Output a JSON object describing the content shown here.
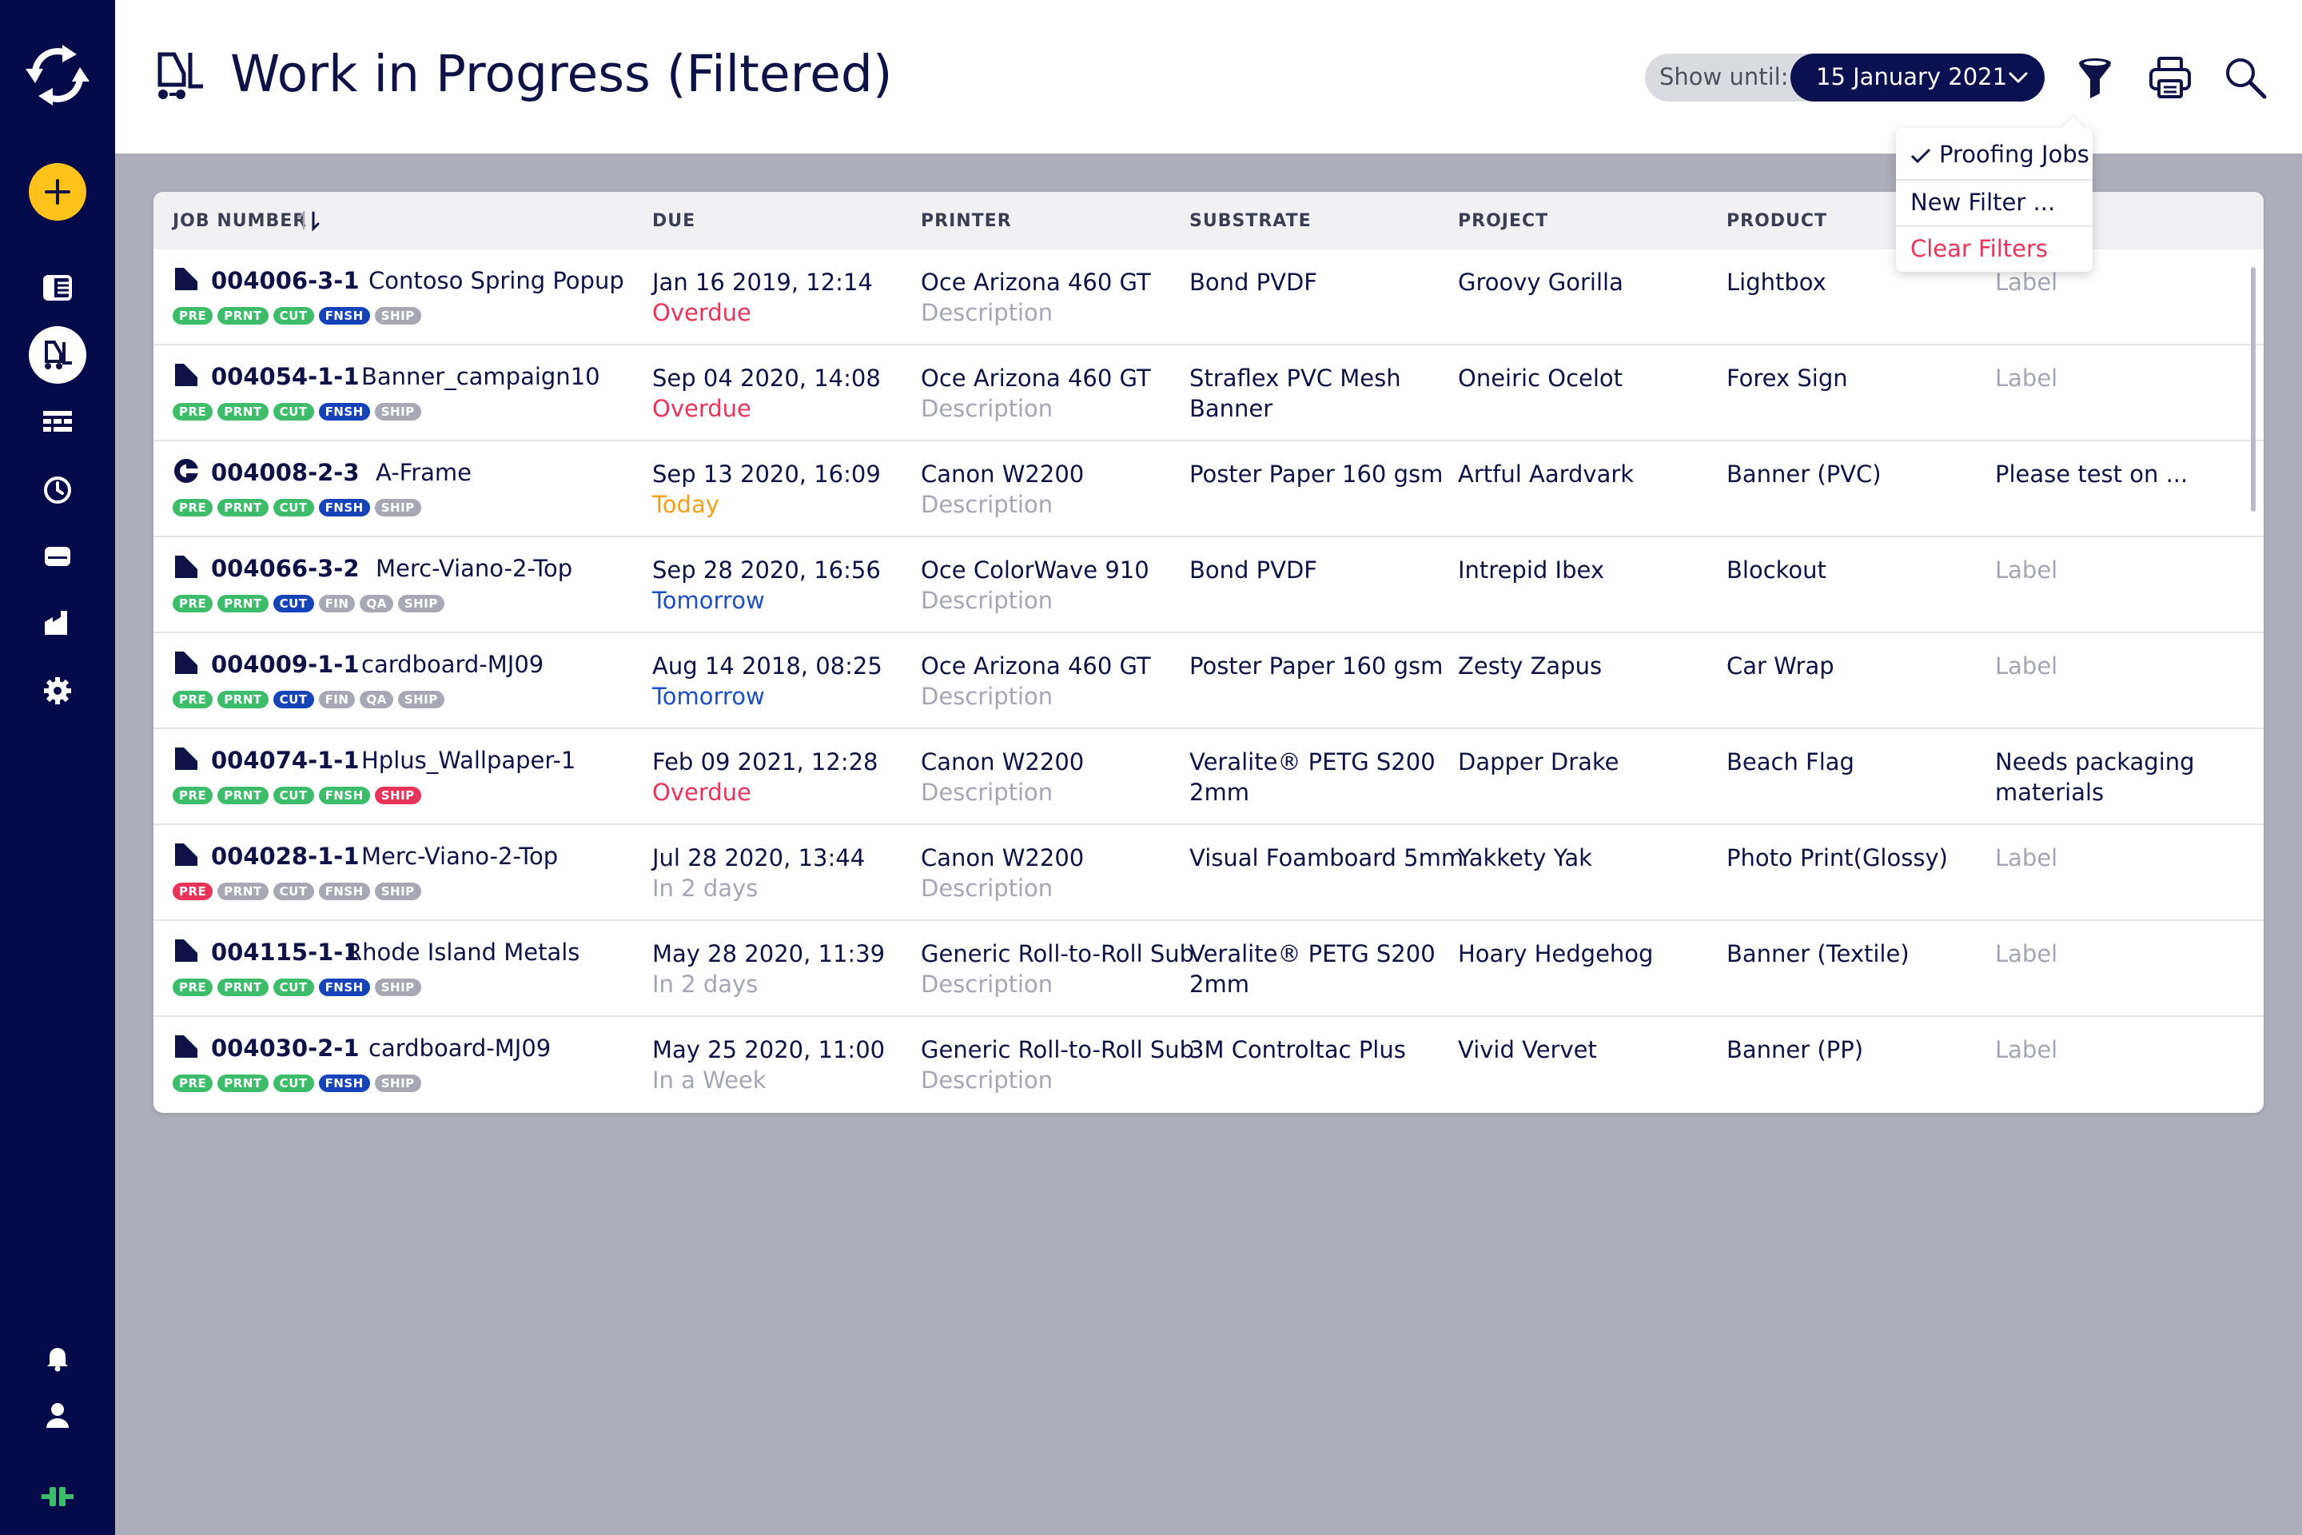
{
  "sidebar": {
    "logo": "refresh-cycle-logo",
    "add_icon": "plus-icon",
    "nav": [
      "list-icon",
      "work-in-progress-icon",
      "board-icon",
      "clock-icon",
      "printer-icon",
      "factory-icon",
      "gear-icon"
    ],
    "bottom": [
      "bell-icon",
      "user-icon",
      "connector-icon"
    ],
    "active_item": "work-in-progress-icon"
  },
  "header": {
    "title": "Work in Progress (Filtered)",
    "title_icon": "forklift-icon",
    "show_until_label": "Show until:",
    "show_until_value": "15 January 2021",
    "actions": [
      "filter-icon",
      "print-icon",
      "search-icon"
    ]
  },
  "filter_menu": {
    "items": [
      {
        "label": "Proofing Jobs",
        "checked": true
      },
      {
        "label": "New Filter ..."
      },
      {
        "label": "Clear Filters",
        "color": "#e8345a"
      }
    ]
  },
  "table": {
    "columns": [
      "JOB NUMBER",
      "DUE",
      "PRINTER",
      "SUBSTRATE",
      "PROJECT",
      "PRODUCT"
    ],
    "rows": [
      {
        "icon": "document-icon",
        "job": "004006-3-1",
        "name": "Contoso Spring Popup",
        "tags": [
          [
            "PRE",
            "green"
          ],
          [
            "PRNT",
            "green"
          ],
          [
            "CUT",
            "green"
          ],
          [
            "FNSH",
            "blue"
          ],
          [
            "SHIP",
            "gray"
          ]
        ],
        "due": "Jan 16 2019, 12:14",
        "due_status": "Overdue",
        "due_class": "overdue",
        "printer": "Oce Arizona 460 GT",
        "printer_desc": "Description",
        "substrate": [
          "Bond PVDF"
        ],
        "project": "Groovy Gorilla",
        "product": "Lightbox",
        "label": "Label",
        "label_muted": true
      },
      {
        "icon": "document-icon",
        "job": "004054-1-1",
        "name": "Banner_campaign10",
        "tags": [
          [
            "PRE",
            "green"
          ],
          [
            "PRNT",
            "green"
          ],
          [
            "CUT",
            "green"
          ],
          [
            "FNSH",
            "blue"
          ],
          [
            "SHIP",
            "gray"
          ]
        ],
        "due": "Sep 04 2020, 14:08",
        "due_status": "Overdue",
        "due_class": "overdue",
        "printer": "Oce Arizona 460 GT",
        "printer_desc": "Description",
        "substrate": [
          "Straflex PVC Mesh",
          "Banner"
        ],
        "project": "Oneiric Ocelot",
        "product": "Forex Sign",
        "label": "Label",
        "label_muted": true
      },
      {
        "icon": "half-circle-icon",
        "job": "004008-2-3",
        "name": "A-Frame",
        "tags": [
          [
            "PRE",
            "green"
          ],
          [
            "PRNT",
            "green"
          ],
          [
            "CUT",
            "green"
          ],
          [
            "FNSH",
            "blue"
          ],
          [
            "SHIP",
            "gray"
          ]
        ],
        "due": "Sep 13 2020, 16:09",
        "due_status": "Today",
        "due_class": "today",
        "printer": "Canon W2200",
        "printer_desc": "Description",
        "substrate": [
          "Poster Paper 160 gsm"
        ],
        "project": "Artful Aardvark",
        "product": "Banner (PVC)",
        "label": "Please test on ...",
        "label_muted": false
      },
      {
        "icon": "document-icon",
        "job": "004066-3-2",
        "name": "Merc-Viano-2-Top",
        "tags": [
          [
            "PRE",
            "green"
          ],
          [
            "PRNT",
            "green"
          ],
          [
            "CUT",
            "blue"
          ],
          [
            "FIN",
            "gray"
          ],
          [
            "QA",
            "gray"
          ],
          [
            "SHIP",
            "gray"
          ]
        ],
        "due": "Sep 28 2020, 16:56",
        "due_status": "Tomorrow",
        "due_class": "tomorrow",
        "printer": "Oce ColorWave 910",
        "printer_desc": "Description",
        "substrate": [
          "Bond PVDF"
        ],
        "project": "Intrepid Ibex",
        "product": "Blockout",
        "label": "Label",
        "label_muted": true
      },
      {
        "icon": "document-icon",
        "job": "004009-1-1",
        "name": "cardboard-MJ09",
        "tags": [
          [
            "PRE",
            "green"
          ],
          [
            "PRNT",
            "green"
          ],
          [
            "CUT",
            "blue"
          ],
          [
            "FIN",
            "gray"
          ],
          [
            "QA",
            "gray"
          ],
          [
            "SHIP",
            "gray"
          ]
        ],
        "due": "Aug 14 2018, 08:25",
        "due_status": "Tomorrow",
        "due_class": "tomorrow",
        "printer": "Oce Arizona 460 GT",
        "printer_desc": "Description",
        "substrate": [
          "Poster Paper 160 gsm"
        ],
        "project": "Zesty Zapus",
        "product": "Car Wrap",
        "label": "Label",
        "label_muted": true
      },
      {
        "icon": "document-icon",
        "job": "004074-1-1",
        "name": "Hplus_Wallpaper-1",
        "tags": [
          [
            "PRE",
            "green"
          ],
          [
            "PRNT",
            "green"
          ],
          [
            "CUT",
            "green"
          ],
          [
            "FNSH",
            "green"
          ],
          [
            "SHIP",
            "red"
          ]
        ],
        "due": "Feb 09 2021, 12:28",
        "due_status": "Overdue",
        "due_class": "overdue",
        "printer": "Canon W2200",
        "printer_desc": "Description",
        "substrate": [
          "Veralite® PETG S200",
          "2mm"
        ],
        "project": "Dapper Drake",
        "product": "Beach Flag",
        "label": "Needs packaging materials",
        "label_muted": false
      },
      {
        "icon": "document-icon",
        "job": "004028-1-1",
        "name": "Merc-Viano-2-Top",
        "tags": [
          [
            "PRE",
            "red"
          ],
          [
            "PRNT",
            "gray"
          ],
          [
            "CUT",
            "gray"
          ],
          [
            "FNSH",
            "gray"
          ],
          [
            "SHIP",
            "gray"
          ]
        ],
        "due": "Jul 28 2020, 13:44",
        "due_status": "In 2 days",
        "due_class": "muted",
        "printer": "Canon W2200",
        "printer_desc": "Description",
        "substrate": [
          "Visual Foamboard 5mm"
        ],
        "project": "Yakkety Yak",
        "product": "Photo Print(Glossy)",
        "label": "Label",
        "label_muted": true
      },
      {
        "icon": "document-icon",
        "job": "004115-1-1",
        "name": "Rhode Island Metals",
        "tags": [
          [
            "PRE",
            "green"
          ],
          [
            "PRNT",
            "green"
          ],
          [
            "CUT",
            "green"
          ],
          [
            "FNSH",
            "blue"
          ],
          [
            "SHIP",
            "gray"
          ]
        ],
        "due": "May 28 2020, 11:39",
        "due_status": "In 2 days",
        "due_class": "muted",
        "printer": "Generic Roll-to-Roll Sub",
        "printer_desc": "Description",
        "substrate": [
          "Veralite® PETG S200",
          "2mm"
        ],
        "project": "Hoary Hedgehog",
        "product": "Banner (Textile)",
        "label": "Label",
        "label_muted": true
      },
      {
        "icon": "document-icon",
        "job": "004030-2-1",
        "name": "cardboard-MJ09",
        "tags": [
          [
            "PRE",
            "green"
          ],
          [
            "PRNT",
            "green"
          ],
          [
            "CUT",
            "green"
          ],
          [
            "FNSH",
            "blue"
          ],
          [
            "SHIP",
            "gray"
          ]
        ],
        "due": "May 25 2020, 11:00",
        "due_status": "In a Week",
        "due_class": "muted",
        "printer": "Generic Roll-to-Roll Sub",
        "printer_desc": "Description",
        "substrate": [
          "3M Controltac Plus"
        ],
        "project": "Vivid Vervet",
        "product": "Banner (PP)",
        "label": "Label",
        "label_muted": true
      }
    ]
  },
  "colors": {
    "sidebar": "#050a4a",
    "accent_yellow": "#ffc21a",
    "overdue": "#e8345a",
    "today": "#f2a11a",
    "tomorrow": "#1c4fc0",
    "tag_green": "#3dbc6a",
    "tag_blue": "#1644b8",
    "tag_gray": "#a7a8b3",
    "tag_red": "#e8345a"
  }
}
